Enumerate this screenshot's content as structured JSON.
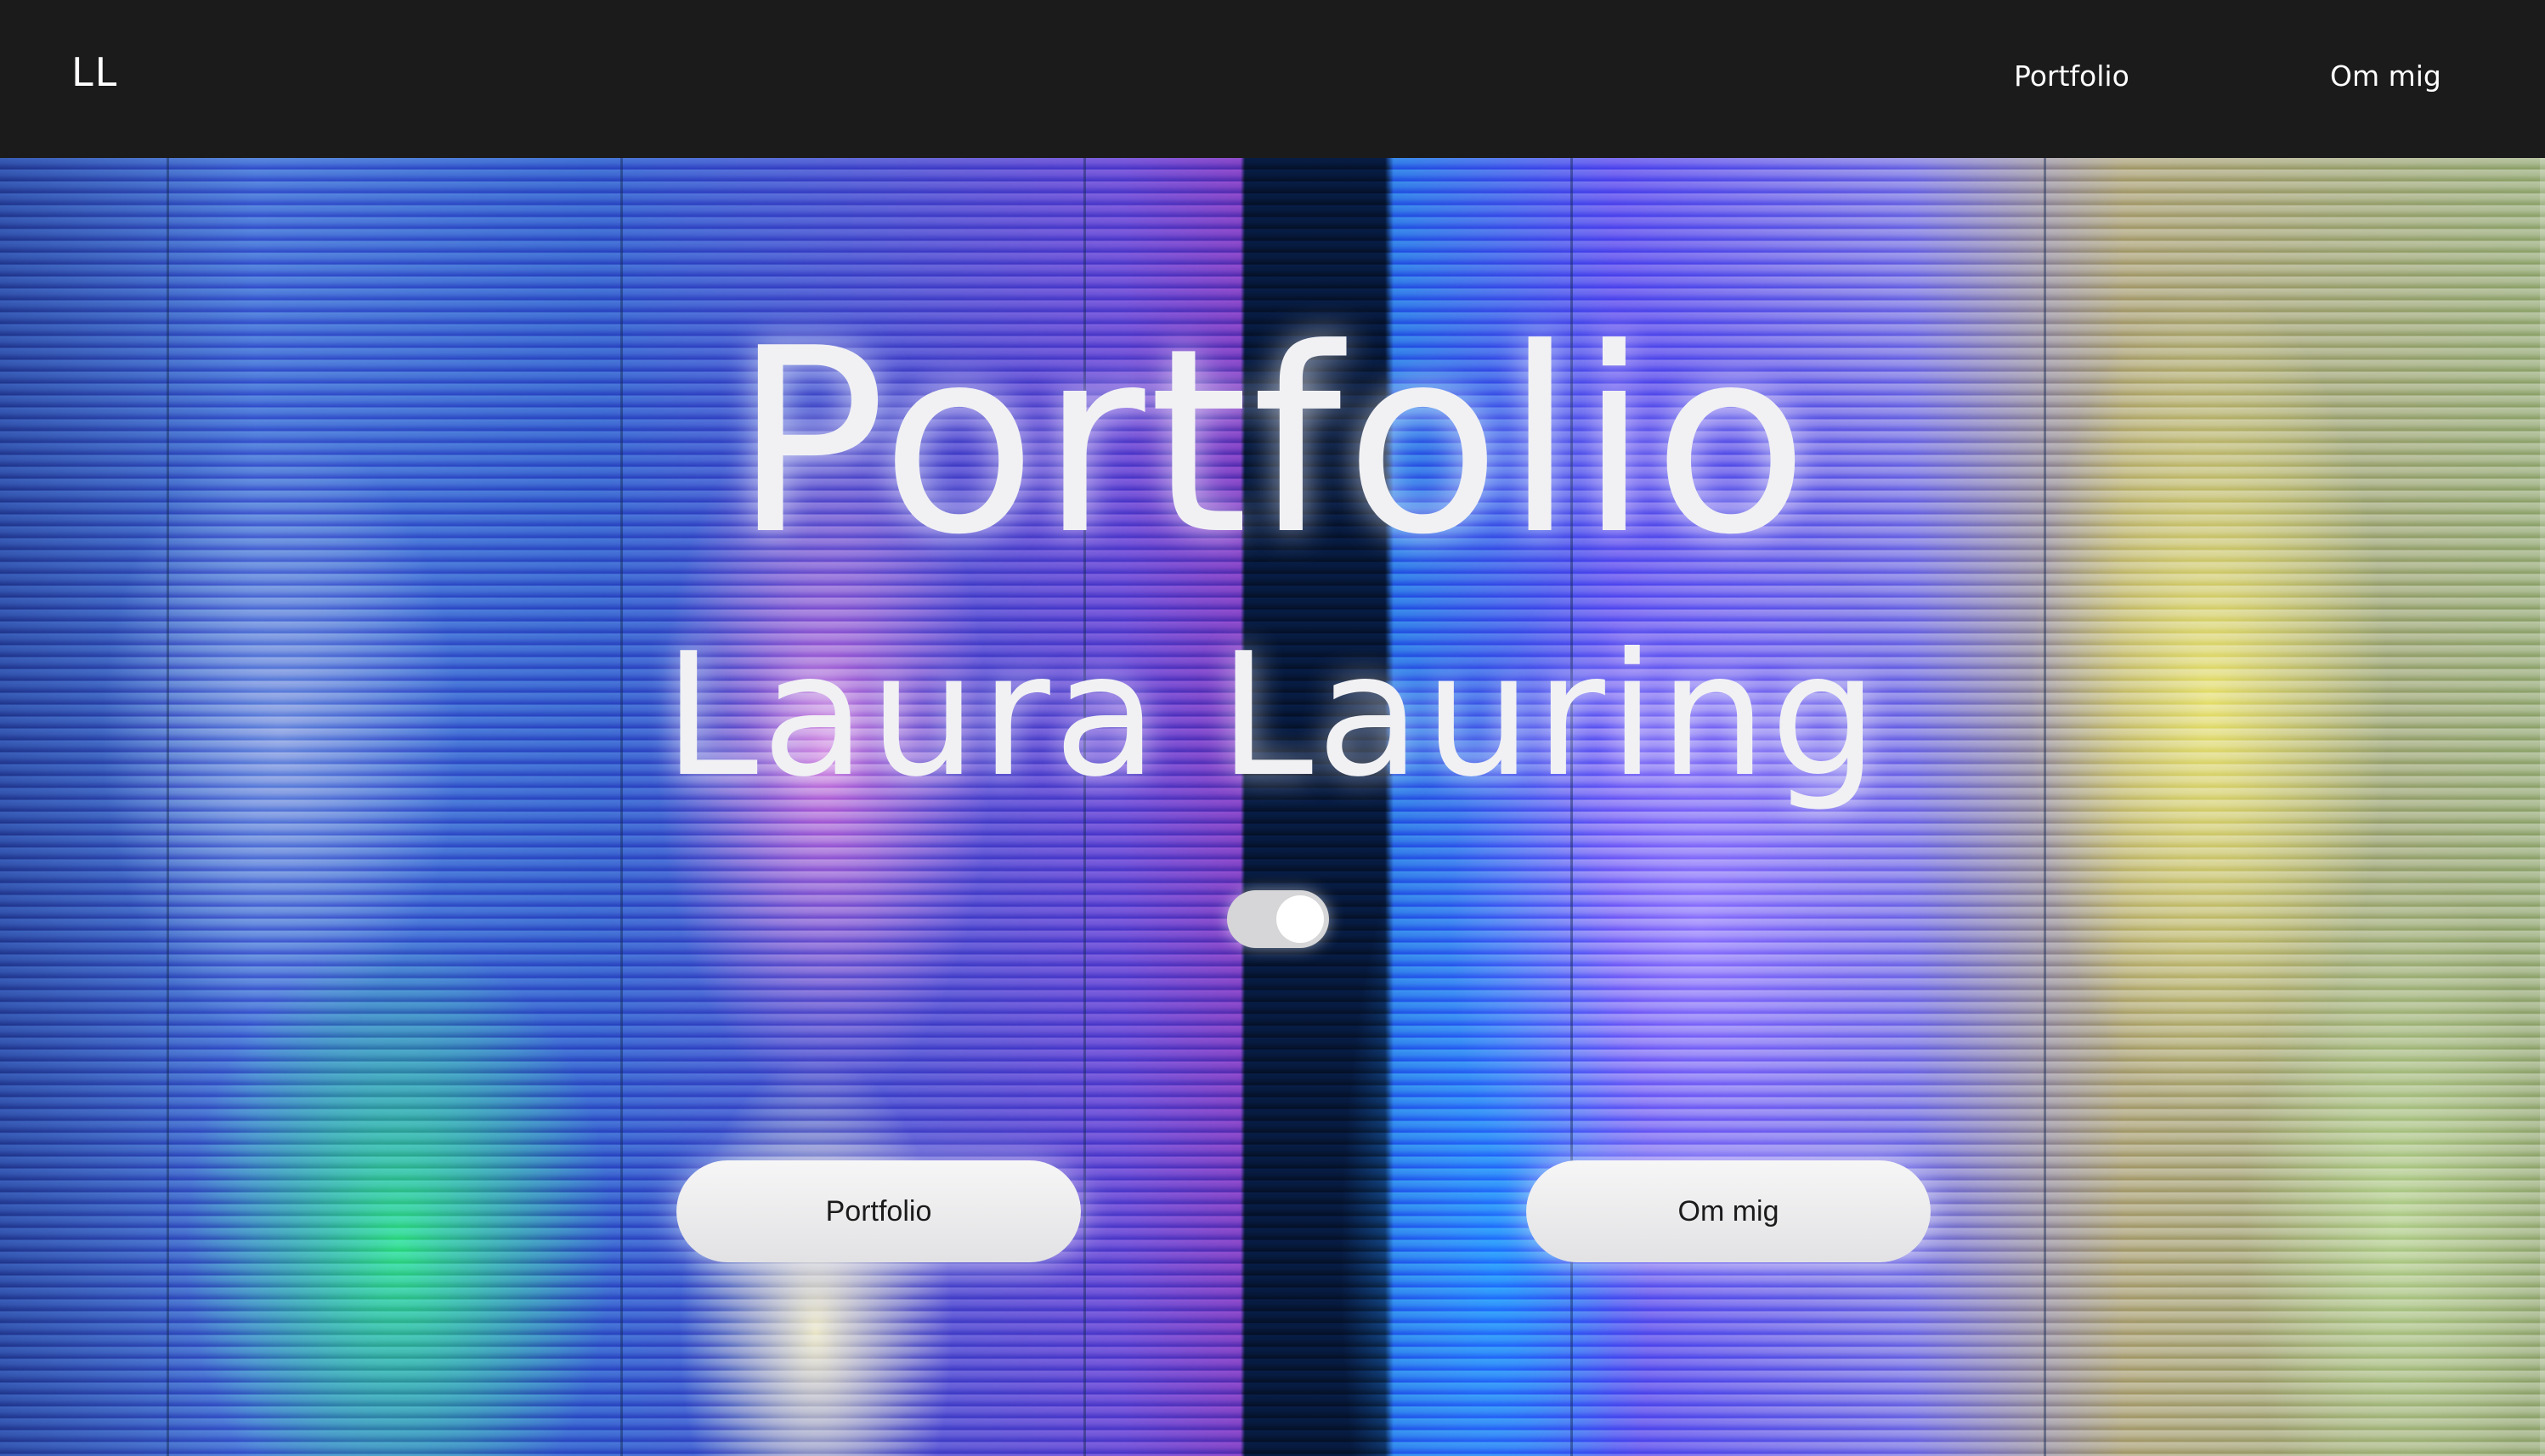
{
  "header": {
    "logo": "LL",
    "nav": [
      {
        "label": "Portfolio"
      },
      {
        "label": "Om mig"
      }
    ]
  },
  "hero": {
    "title": "Portfolio",
    "name": "Laura Lauring",
    "toggle_state": "on",
    "buttons": [
      {
        "label": "Portfolio"
      },
      {
        "label": "Om mig"
      }
    ]
  },
  "colors": {
    "header_bg": "#1c1b1c",
    "text_light": "#ffffff",
    "button_bg": "#f0f0f1",
    "button_text": "#1c1b1c"
  }
}
